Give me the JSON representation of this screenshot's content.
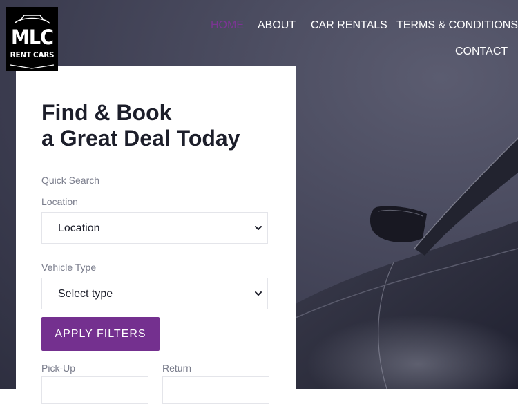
{
  "logo": {
    "line1": "MLC",
    "line2": "RENT CARS"
  },
  "nav": {
    "items": [
      {
        "label": "HOME",
        "active": true
      },
      {
        "label": "ABOUT"
      },
      {
        "label": "CAR RENTALS"
      },
      {
        "label": "TERMS & CONDITIONS"
      },
      {
        "label": "CONTACT"
      }
    ]
  },
  "search": {
    "headline_line1": "Find & Book",
    "headline_line2": "a Great Deal Today",
    "quick_search": "Quick Search",
    "location_label": "Location",
    "location_value": "Location",
    "vehicle_label": "Vehicle Type",
    "vehicle_value": "Select type",
    "apply_button": "APPLY FILTERS",
    "pickup_label": "Pick-Up",
    "return_label": "Return"
  },
  "icons": {
    "dropdown": "chevron-down-icon",
    "logo_emblem": "car-silhouette-icon"
  },
  "colors": {
    "accent": "#74308f",
    "nav_active": "#7b3593",
    "text_dark": "#1c1e2a",
    "label": "#7a7d8c",
    "hero_bg": "#4a4b5f"
  }
}
